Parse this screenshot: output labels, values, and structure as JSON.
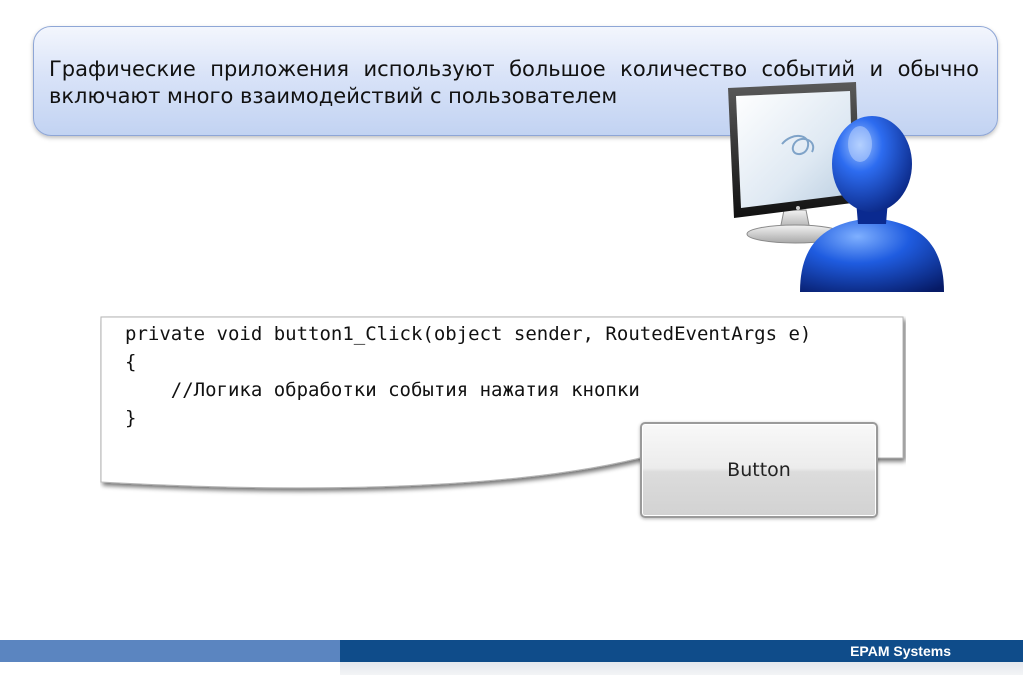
{
  "callout": {
    "text": "Графические приложения используют большое количество событий и обычно включают много взаимодействий с пользователем"
  },
  "illustration": {
    "icons": [
      "monitor-icon",
      "user-icon"
    ]
  },
  "code": {
    "line1": "private void button1_Click(object sender, RoutedEventArgs e)",
    "line2": "{",
    "line3": "    //Логика обработки события нажатия кнопки",
    "line4": "}"
  },
  "button": {
    "label": "Button"
  },
  "footer": {
    "brand": "EPAM Systems"
  },
  "colors": {
    "callout_top": "#f3f6fd",
    "callout_bottom": "#c2d3f2",
    "footer_light": "#5b85c0",
    "footer_dark": "#0f4c8a",
    "user_blue": "#1a4fd6"
  }
}
